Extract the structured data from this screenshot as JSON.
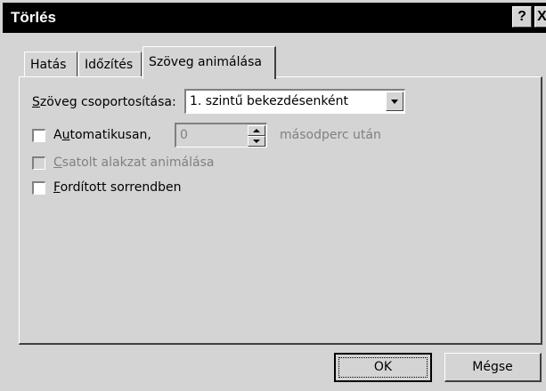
{
  "window": {
    "title": "Törlés",
    "help_label": "?",
    "close_label": "X"
  },
  "tabs": [
    {
      "label": "Hatás",
      "active": false
    },
    {
      "label": "Időzítés",
      "active": false
    },
    {
      "label": "Szöveg animálása",
      "active": true
    }
  ],
  "form": {
    "group_label_key": "S",
    "group_label_rest": "zöveg csoportosítása:",
    "group_value": "1. szintű bekezdésenként",
    "auto_label_pre": "A",
    "auto_label_key": "u",
    "auto_label_rest": "tomatikusan,",
    "auto_checked": false,
    "auto_seconds": "0",
    "auto_unit": "másodperc után",
    "attached_label_key": "C",
    "attached_label_rest": "satolt alakzat animálása",
    "attached_checked": false,
    "reverse_label_key": "F",
    "reverse_label_rest": "ordított sorrendben",
    "reverse_checked": false
  },
  "buttons": {
    "ok": "OK",
    "cancel": "Mégse"
  }
}
